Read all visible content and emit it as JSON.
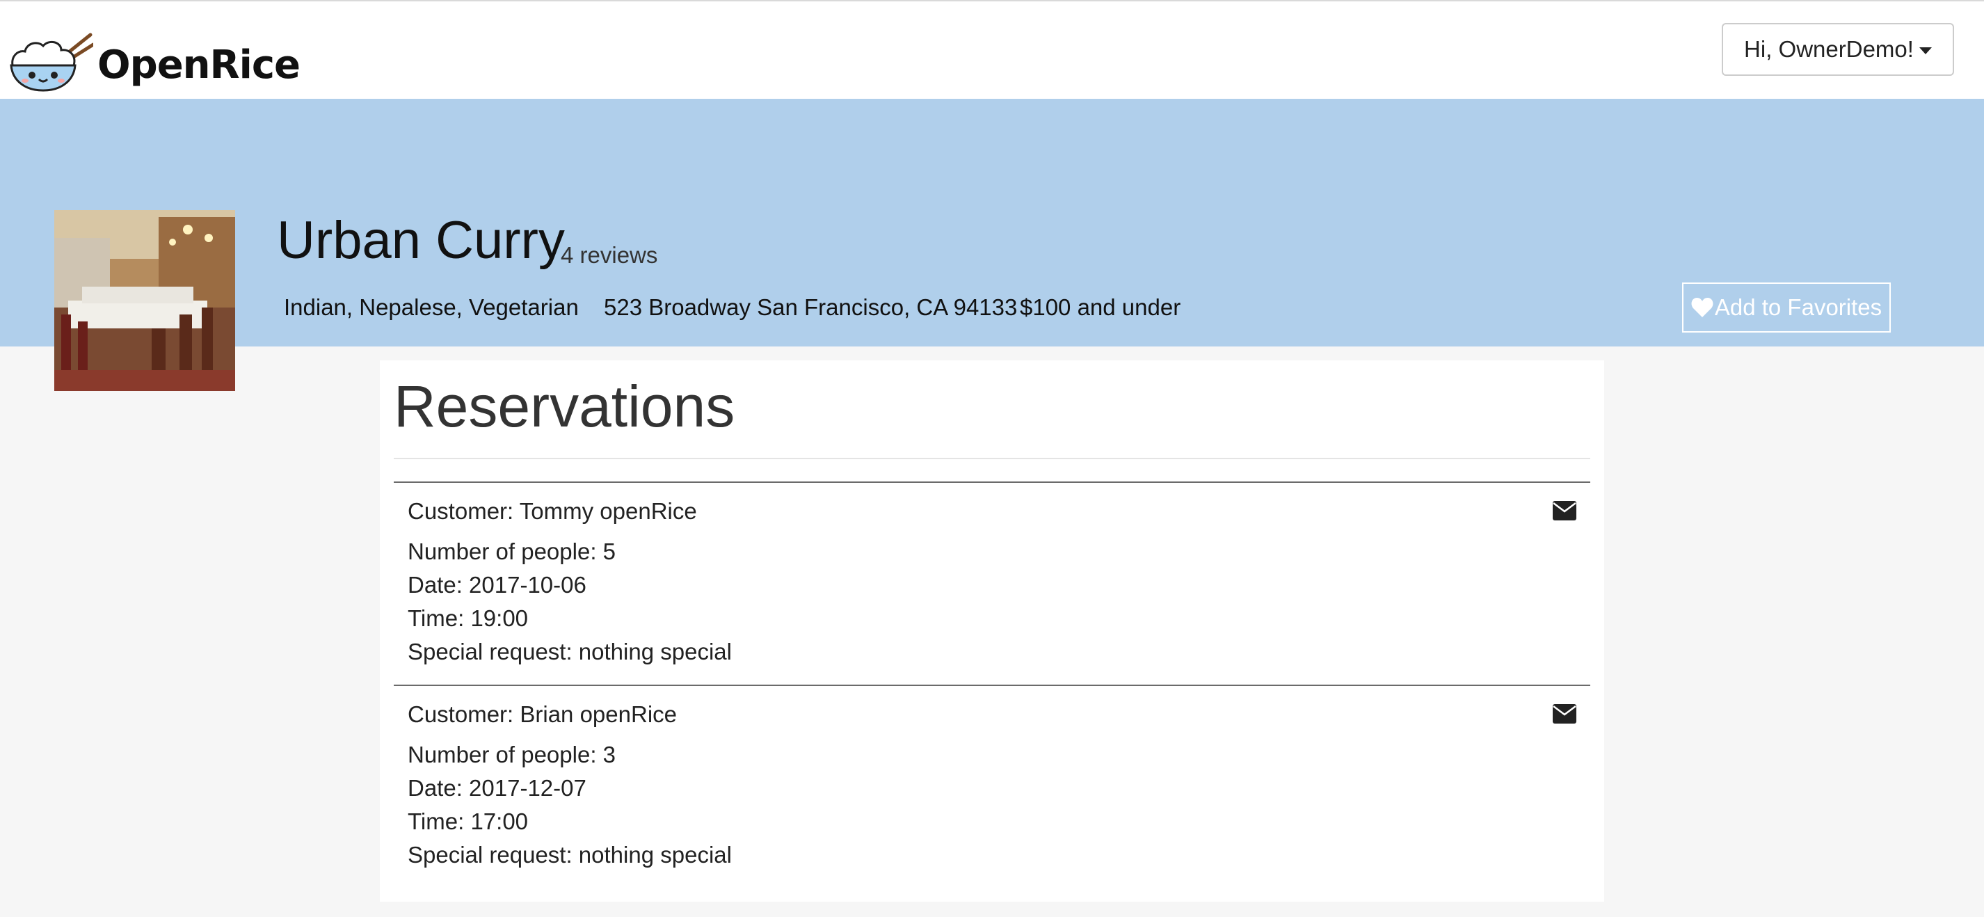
{
  "nav": {
    "brand_name": "OpenRice",
    "user_menu_label": "Hi, OwnerDemo!",
    "logo_icon": "rice-bowl-logo-icon",
    "caret_icon": "caret-down-icon"
  },
  "restaurant": {
    "name": "Urban Curry",
    "reviews": "4 reviews",
    "cuisine": "Indian, Nepalese, Vegetarian",
    "address": "523 Broadway San Francisco, CA 94133",
    "price": "$100 and under",
    "favorite_label": "Add to Favorites",
    "favorite_icon": "heart-icon",
    "banner_color": "#b0cfeb"
  },
  "reservations": {
    "title": "Reservations",
    "mail_icon": "envelope-icon",
    "items": [
      {
        "customer": "Customer: Tommy openRice",
        "people": "Number of people: 5",
        "date": "Date: 2017-10-06",
        "time": "Time: 19:00",
        "request": "Special request: nothing special"
      },
      {
        "customer": "Customer: Brian openRice",
        "people": "Number of people: 3",
        "date": "Date: 2017-12-07",
        "time": "Time: 17:00",
        "request": "Special request: nothing special"
      }
    ]
  }
}
